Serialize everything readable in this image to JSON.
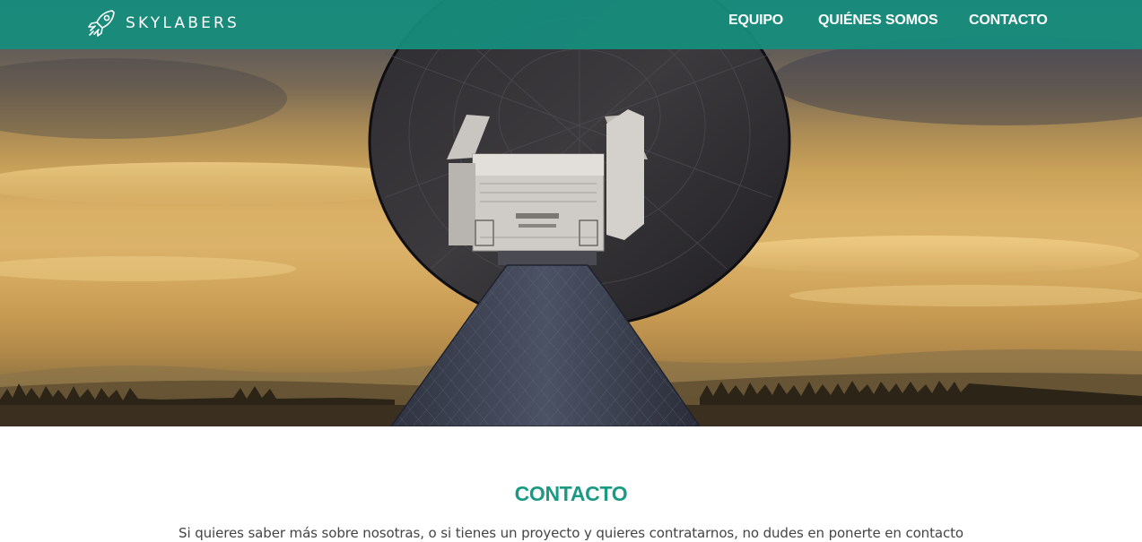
{
  "header": {
    "brand": "SKYLABERS",
    "brand_icon": "rocket-icon",
    "nav": [
      "EQUIPO",
      "QUIÉNES SOMOS",
      "CONTACTO"
    ]
  },
  "hero": {
    "image": "satellite-dish-at-sunset"
  },
  "contact": {
    "title": "CONTACTO",
    "text": "Si quieres saber más sobre nosotras, o si tienes un proyecto y quieres contratarnos, no dudes en ponerte en contacto"
  },
  "colors": {
    "header_bg": "#168e7e",
    "accent": "#1a9a84",
    "body_text": "#444444"
  }
}
